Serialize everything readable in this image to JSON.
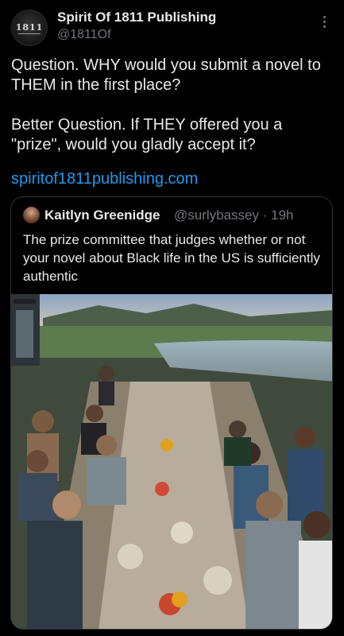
{
  "author": {
    "name": "Spirit Of 1811 Publishing",
    "handle": "@1811Of",
    "avatar_text": "1811"
  },
  "tweet": {
    "text": "Question. WHY would you submit a novel to THEM in the first place?\n\nBetter Question. If THEY offered you a \"prize\", would you gladly accept it?",
    "link": "spiritof1811publishing.com"
  },
  "quoted_tweet": {
    "name": "Kaitlyn Greenidge",
    "handle": "@surlybassey",
    "time": "19h",
    "text": "The prize committee that judges whether or not your novel about Black life in the US is sufficiently authentic"
  },
  "colors": {
    "background": "#000000",
    "text": "#e7e9ea",
    "secondary": "#71767b",
    "link": "#1d9bf0",
    "border": "#2f3336"
  },
  "icons": [
    "more-options-icon"
  ]
}
